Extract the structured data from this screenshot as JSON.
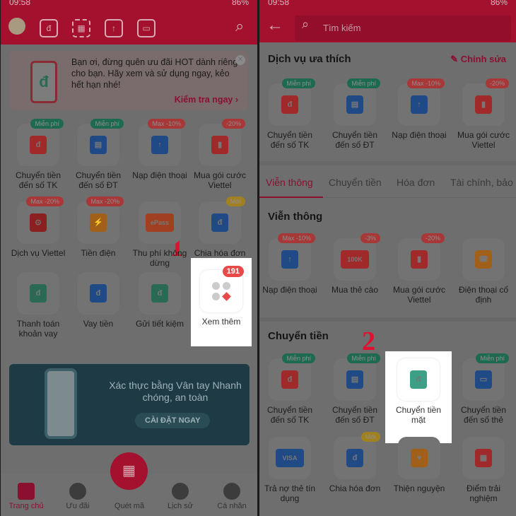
{
  "status": {
    "time": "09:58",
    "battery": "86%"
  },
  "left": {
    "banner": {
      "text": "Bạn ơi, đừng quên ưu đãi HOT dành riêng cho bạn. Hãy xem và sử dụng ngay, kẻo hết hạn nhé!",
      "cta": "Kiểm tra ngay ›",
      "illus": "đ"
    },
    "tiles": [
      {
        "label": "Chuyển tiền đến số TK",
        "badge": "Miễn phí",
        "bc": "#1d6a50",
        "ic": "#a02a2a",
        "g": "đ"
      },
      {
        "label": "Chuyển tiền đến số ĐT",
        "badge": "Miễn phí",
        "bc": "#1d6a50",
        "ic": "#1f4a85",
        "g": "▤"
      },
      {
        "label": "Nạp điện thoại",
        "badge": "Max -10%",
        "bc": "#a83838",
        "ic": "#1f4a85",
        "g": "↑"
      },
      {
        "label": "Mua gói cước Viettel",
        "badge": "-20%",
        "bc": "#a83838",
        "ic": "#a02a2a",
        "g": "▮"
      },
      {
        "label": "Dịch vụ Viettel",
        "badge": "Max -20%",
        "bc": "#a83838",
        "ic": "#8a2020",
        "g": "⊙"
      },
      {
        "label": "Tiền điện",
        "badge": "Max -20%",
        "bc": "#a83838",
        "ic": "#a0601a",
        "g": "⚡"
      },
      {
        "label": "Thu phí không dừng",
        "badge": "",
        "bc": "",
        "ic": "#a04020",
        "g": "ePass"
      },
      {
        "label": "Chia hóa đơn",
        "badge": "Mới",
        "bc": "#a08020",
        "ic": "#1f4a85",
        "g": "đ"
      },
      {
        "label": "Thanh toán khoản vay",
        "badge": "",
        "bc": "",
        "ic": "#2a6a55",
        "g": "đ"
      },
      {
        "label": "Vay tiền",
        "badge": "",
        "bc": "",
        "ic": "#1f4a85",
        "g": "đ"
      },
      {
        "label": "Gửi tiết kiệm",
        "badge": "",
        "bc": "",
        "ic": "#2a6a55",
        "g": "đ"
      }
    ],
    "more": {
      "label": "Xem thêm",
      "badge": "191"
    },
    "step": "1",
    "fingerprint": {
      "title": "Xác thực bằng Vân tay Nhanh chóng, an toàn",
      "button": "CÀI ĐẶT NGAY"
    },
    "nav": [
      "Trang chủ",
      "Ưu đãi",
      "Quét mã",
      "Lịch sử",
      "Cá nhân"
    ]
  },
  "right": {
    "search_placeholder": "Tìm kiếm",
    "fav_title": "Dịch vụ ưa thích",
    "edit": "✎ Chỉnh sửa",
    "fav": [
      {
        "label": "Chuyển tiền đến số TK",
        "badge": "Miễn phí",
        "bc": "#1d6a50",
        "ic": "#a02a2a",
        "g": "đ"
      },
      {
        "label": "Chuyển tiền đến số ĐT",
        "badge": "Miễn phí",
        "bc": "#1d6a50",
        "ic": "#1f4a85",
        "g": "▤"
      },
      {
        "label": "Nạp điện thoại",
        "badge": "Max -10%",
        "bc": "#a83838",
        "ic": "#1f4a85",
        "g": "↑"
      },
      {
        "label": "Mua gói cước Viettel",
        "badge": "-20%",
        "bc": "#a83838",
        "ic": "#a02a2a",
        "g": "▮"
      }
    ],
    "tabs": [
      "Viễn thông",
      "Chuyển tiền",
      "Hóa đơn",
      "Tài chính, bảo"
    ],
    "telecom_title": "Viễn thông",
    "telecom": [
      {
        "label": "Nạp điện thoại",
        "badge": "Max -10%",
        "bc": "#a83838",
        "ic": "#1f4a85",
        "g": "↑"
      },
      {
        "label": "Mua thẻ cào",
        "badge": "-3%",
        "bc": "#a83838",
        "ic": "#a02a2a",
        "g": "100K"
      },
      {
        "label": "Mua gói cước Viettel",
        "badge": "-20%",
        "bc": "#a83838",
        "ic": "#a02a2a",
        "g": "▮"
      },
      {
        "label": "Điện thoại cố định",
        "badge": "",
        "bc": "",
        "ic": "#a0601a",
        "g": "☎"
      }
    ],
    "transfer_title": "Chuyển tiền",
    "transfer": [
      {
        "label": "Chuyển tiền đến số TK",
        "badge": "Miễn phí",
        "bc": "#1d6a50",
        "ic": "#a02a2a",
        "g": "đ"
      },
      {
        "label": "Chuyển tiền đến số ĐT",
        "badge": "Miễn phí",
        "bc": "#1d6a50",
        "ic": "#1f4a85",
        "g": "▤"
      },
      {
        "label": "Chuyển tiền mặt",
        "badge": "",
        "bc": "",
        "ic": "#3d9f86",
        "g": "đ"
      },
      {
        "label": "Chuyển tiền đến số thẻ",
        "badge": "Miễn phí",
        "bc": "#1d6a50",
        "ic": "#1f4a85",
        "g": "▭"
      },
      {
        "label": "Trả nợ thẻ tín dụng",
        "badge": "",
        "bc": "",
        "ic": "#1f4a85",
        "g": "VISA"
      },
      {
        "label": "Chia hóa đơn",
        "badge": "Mới",
        "bc": "#a08020",
        "ic": "#1f4a85",
        "g": "đ"
      },
      {
        "label": "Thiện nguyện",
        "badge": "",
        "bc": "",
        "ic": "#a0601a",
        "g": "♥"
      },
      {
        "label": "Điểm trải nghiệm",
        "badge": "",
        "bc": "",
        "ic": "#a02a2a",
        "g": "▦"
      }
    ],
    "step": "2"
  }
}
